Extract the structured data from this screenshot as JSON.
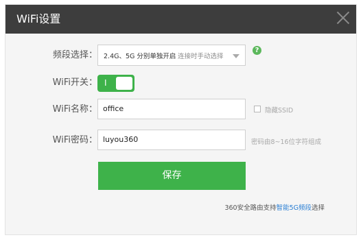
{
  "dialog": {
    "title": "WiFi设置"
  },
  "form": {
    "band": {
      "label": "频段选择：",
      "selected_main": "2.4G、5G 分别单独开启",
      "selected_sub": "连接时手动选择"
    },
    "wifi_switch": {
      "label": "WiFi开关：",
      "state_mark": "I"
    },
    "ssid": {
      "label": "WiFi名称：",
      "value": "office",
      "hide_label": "隐藏SSID"
    },
    "password": {
      "label": "WiFi密码：",
      "value": "luyou360",
      "hint": "密码由8~16位字符组成"
    },
    "help_symbol": "?",
    "save_label": "保存"
  },
  "footer": {
    "prefix": "360安全路由支持",
    "link": "智能5G频段",
    "suffix": "选择"
  },
  "colors": {
    "titlebar": "#3d3d3d",
    "accent": "#3eb24a",
    "link": "#2a7fd4"
  }
}
